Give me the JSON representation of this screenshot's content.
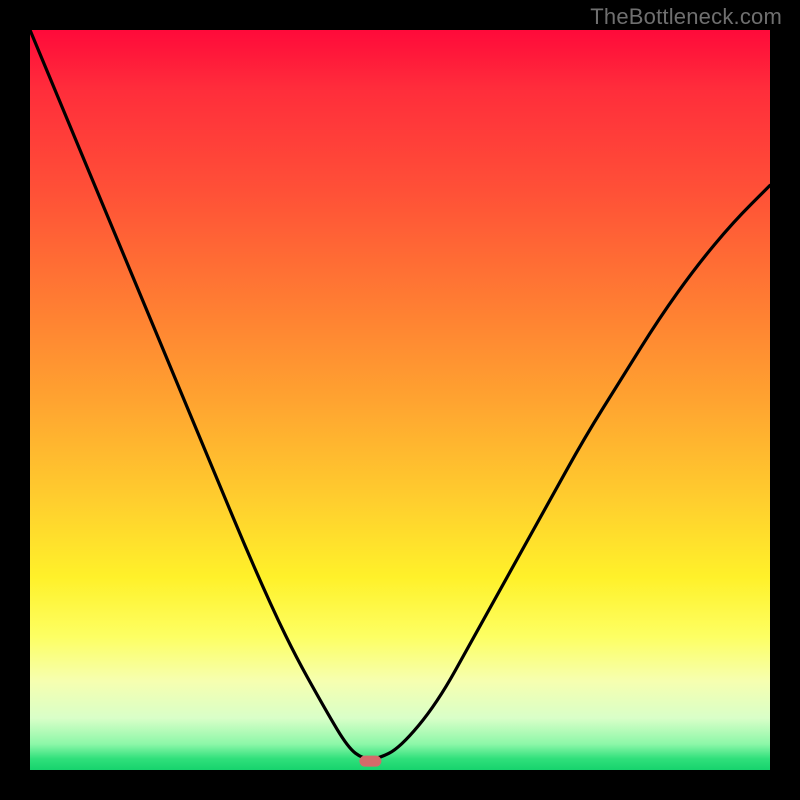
{
  "watermark": "TheBottleneck.com",
  "chart_data": {
    "type": "line",
    "title": "",
    "xlabel": "",
    "ylabel": "",
    "xlim": [
      0,
      1
    ],
    "ylim": [
      0,
      1
    ],
    "series": [
      {
        "name": "bottleneck-curve",
        "x": [
          0.0,
          0.05,
          0.1,
          0.15,
          0.2,
          0.25,
          0.3,
          0.35,
          0.4,
          0.43,
          0.45,
          0.47,
          0.5,
          0.55,
          0.6,
          0.65,
          0.7,
          0.75,
          0.8,
          0.85,
          0.9,
          0.95,
          1.0
        ],
        "y": [
          1.0,
          0.88,
          0.76,
          0.64,
          0.52,
          0.4,
          0.28,
          0.17,
          0.08,
          0.03,
          0.015,
          0.015,
          0.03,
          0.09,
          0.18,
          0.27,
          0.36,
          0.45,
          0.53,
          0.61,
          0.68,
          0.74,
          0.79
        ]
      }
    ],
    "annotations": [
      {
        "type": "min-marker",
        "x": 0.46,
        "y": 0.012
      }
    ],
    "background": {
      "type": "vertical-gradient",
      "stops": [
        {
          "pos": 0.0,
          "color": "#ff0a3a"
        },
        {
          "pos": 0.5,
          "color": "#ffa330"
        },
        {
          "pos": 0.8,
          "color": "#fdff63"
        },
        {
          "pos": 0.98,
          "color": "#2fe07b"
        },
        {
          "pos": 1.0,
          "color": "#17d36d"
        }
      ]
    }
  }
}
